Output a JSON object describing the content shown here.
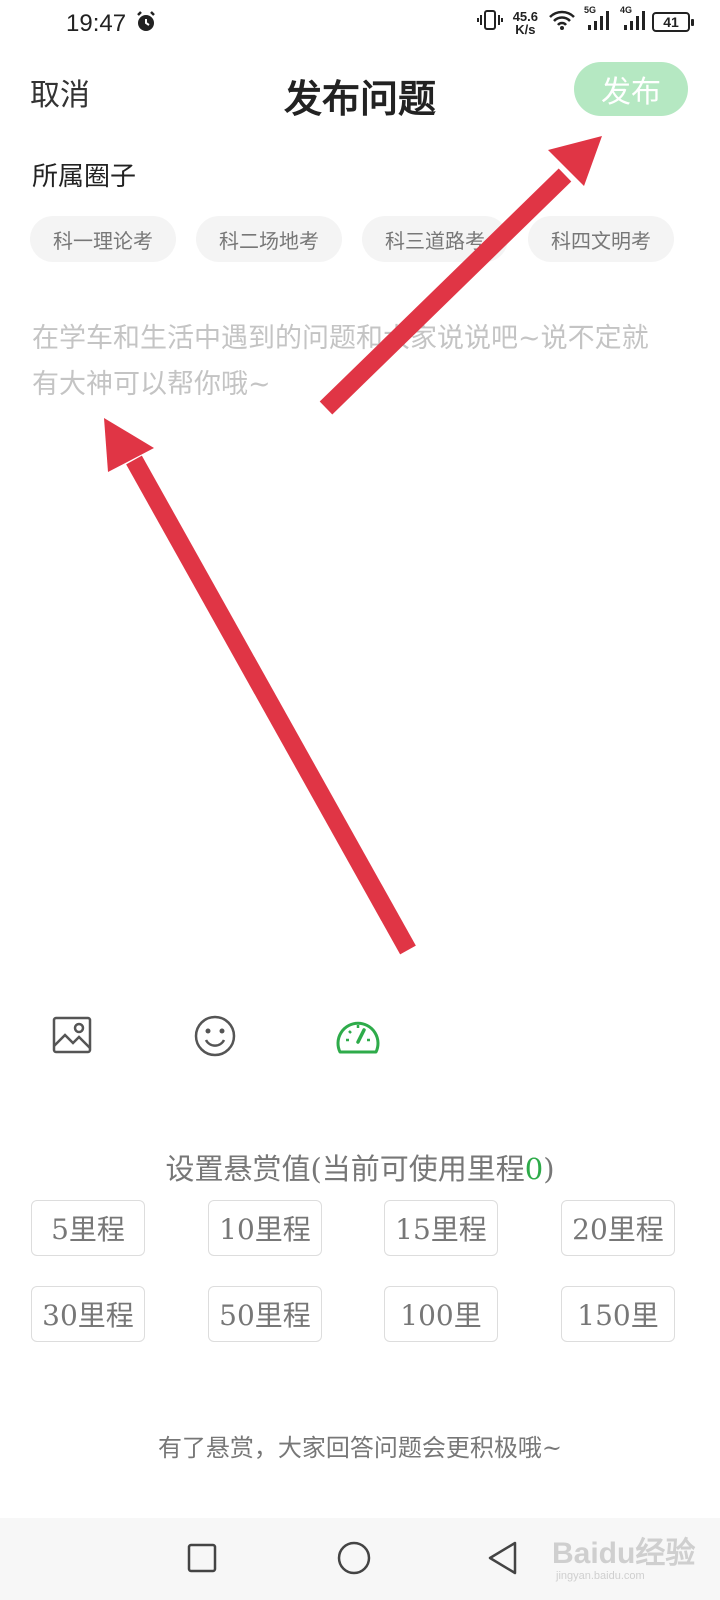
{
  "status_bar": {
    "time": "19:47",
    "net_speed_value": "45.6",
    "net_speed_unit": "K/s",
    "sim1_type": "5G",
    "sim2_type": "4G",
    "battery": "41",
    "icons": [
      "alarm-icon",
      "vibrate-icon",
      "wifi-icon",
      "signal-icon",
      "battery-icon"
    ]
  },
  "header": {
    "cancel_label": "取消",
    "title": "发布问题",
    "publish_label": "发布"
  },
  "circle": {
    "label": "所属圈子",
    "chips": [
      "科一理论考",
      "科二场地考",
      "科三道路考",
      "科四文明考"
    ]
  },
  "editor": {
    "placeholder_line1": "在学车和生活中遇到的问题和大家说说吧~说不定就",
    "placeholder_line2": "有大神可以帮你哦~"
  },
  "toolbar": {
    "icons": [
      "image-icon",
      "emoji-icon",
      "reward-gauge-icon"
    ],
    "active_color": "#2eab4a"
  },
  "reward": {
    "title_prefix": "设置悬赏值(当前可使用里程",
    "available": "0",
    "title_suffix": ")",
    "options": [
      "5里程",
      "10里程",
      "15里程",
      "20里程",
      "30里程",
      "50里程",
      "100里",
      "150里"
    ],
    "hint": "有了悬赏，大家回答问题会更积极哦~"
  },
  "nav": {
    "icons": [
      "recent-apps-icon",
      "home-icon",
      "back-icon"
    ]
  },
  "watermark": {
    "text": "Baidu经验",
    "sub": "jingyan.baidu.com"
  },
  "colors": {
    "publish_bg": "#b5e8c2",
    "accent_green": "#2eab4a",
    "arrow_red": "#e03545"
  }
}
